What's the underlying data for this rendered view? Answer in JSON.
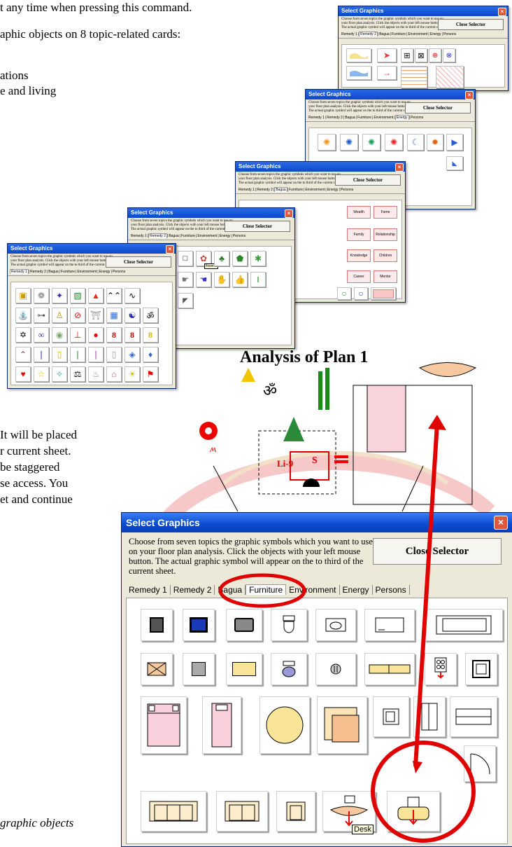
{
  "document": {
    "line1": "t any time when pressing this command.",
    "line2": "aphic objects on 8 topic-related cards:",
    "line3": "ations",
    "line4": "e and living",
    "para1": "It will be placed",
    "para2": "r current sheet.",
    "para3": "be staggered",
    "para4": "se access. You",
    "para5": "et and continue",
    "caption": "graphic objects"
  },
  "dialog": {
    "title": "Select Graphics",
    "description": "Choose from seven topics the graphic symbols which you want to use on your floor plan analysis. Click the objects with your left mouse button. The actual graphic symbol will appear on the to third of the current sheet.",
    "close_label": "Close Selector",
    "tabs": [
      "Remedy 1",
      "Remedy 2",
      "Bagua",
      "Furniture",
      "Environment",
      "Energy",
      "Persons"
    ]
  },
  "bagua_labels": [
    "Wealth",
    "Fame",
    "Family",
    "Relationship",
    "Knowledge",
    "Children",
    "Career",
    "Mentor"
  ],
  "tooltip_flowers": "flowers",
  "tooltip_desk": "Desk",
  "plan": {
    "title": "Analysis of Plan 1",
    "label_li9": "Li-9",
    "label_s": "S"
  },
  "colors": {
    "accent_red": "#e00000",
    "titlebar": "#0a48c8"
  }
}
